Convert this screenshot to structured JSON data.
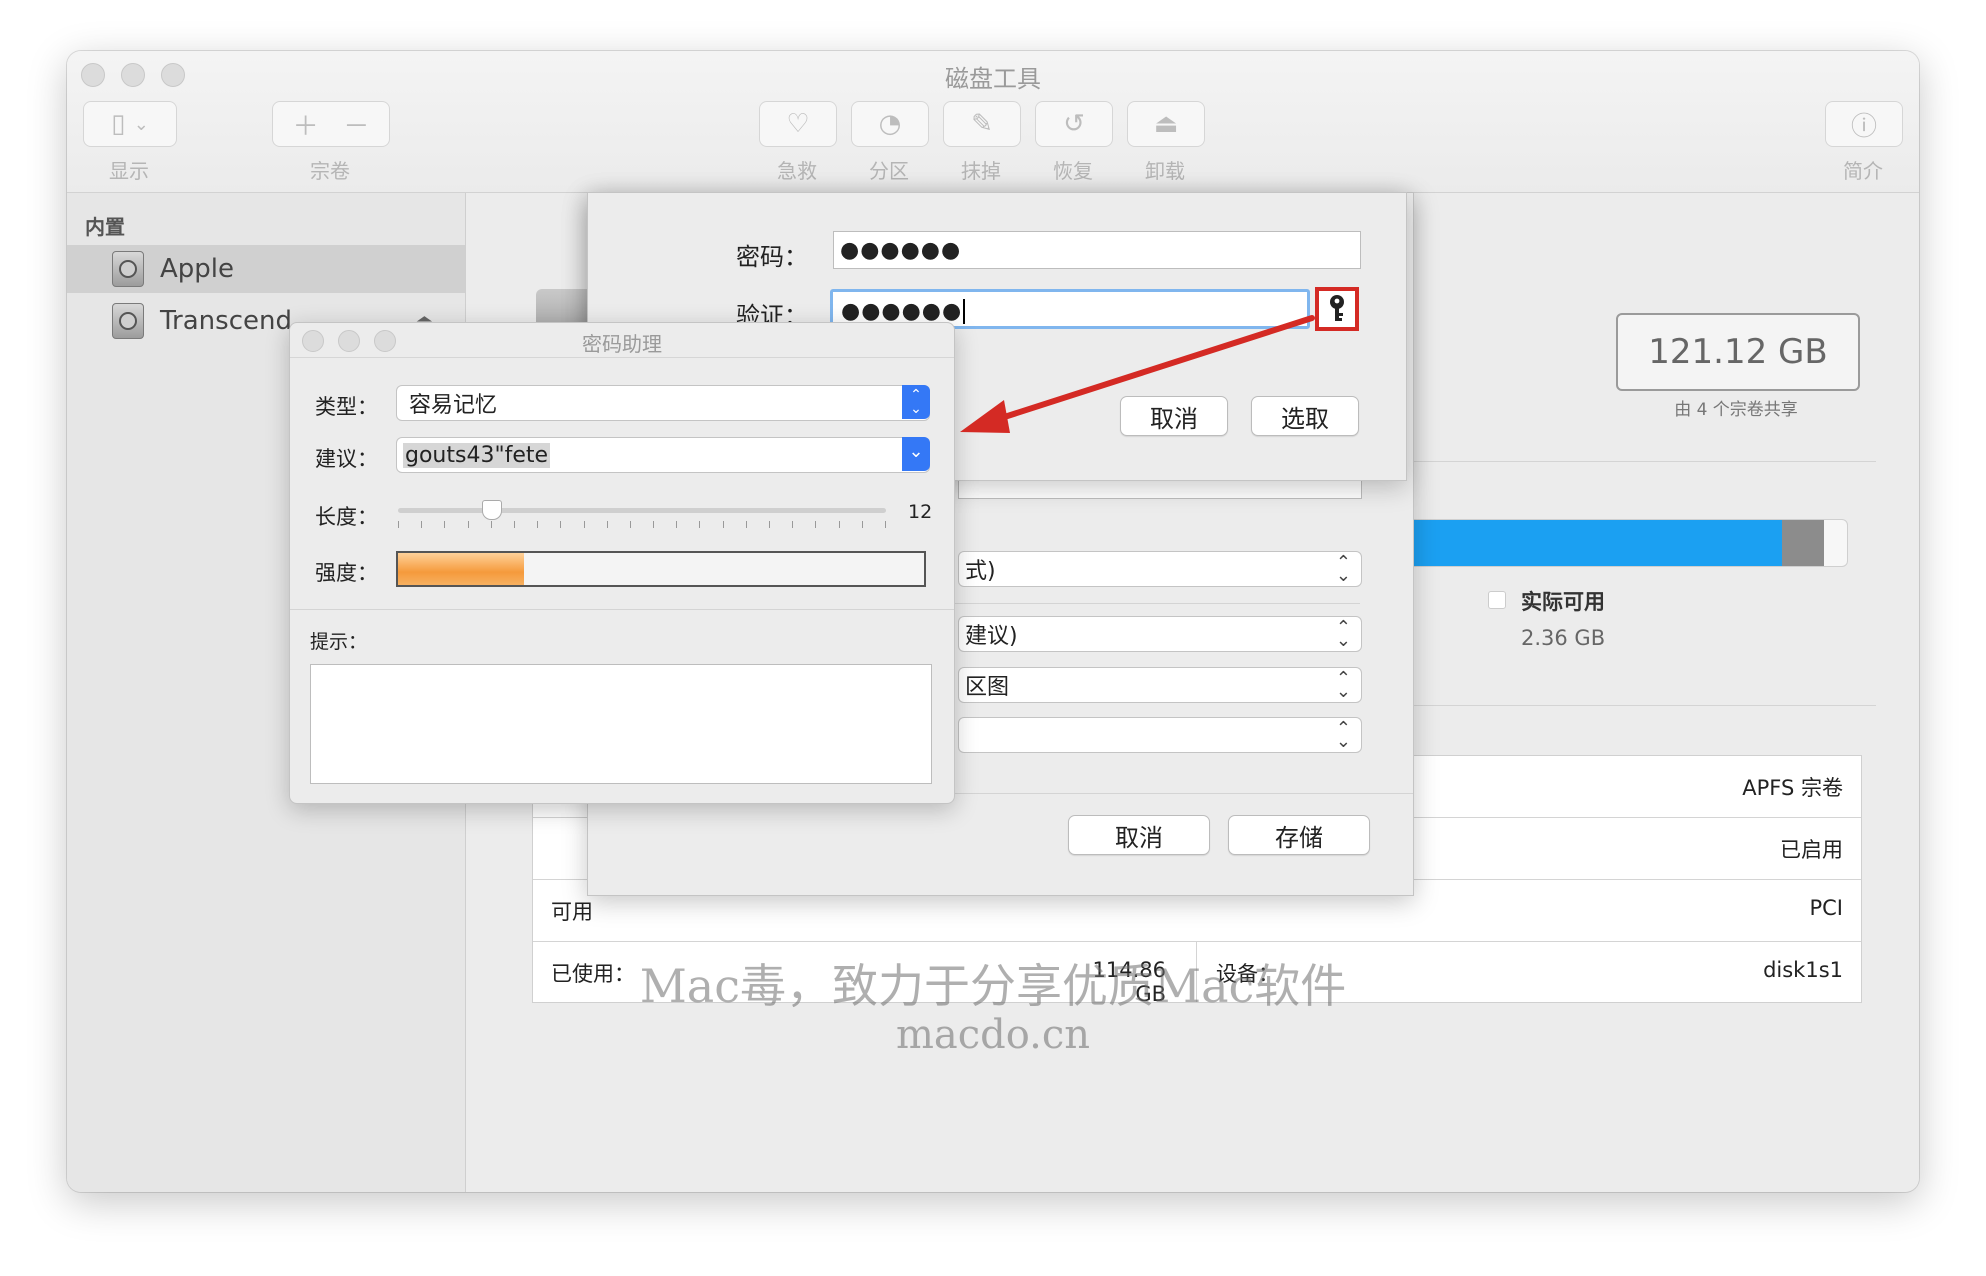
{
  "window": {
    "title": "磁盘工具"
  },
  "toolbar": {
    "view_label": "显示",
    "volume_label": "宗卷",
    "firstaid_label": "急救",
    "partition_label": "分区",
    "erase_label": "抹掉",
    "restore_label": "恢复",
    "unmount_label": "卸载",
    "info_label": "简介"
  },
  "sidebar": {
    "section": "内置",
    "items": [
      {
        "label": "Apple"
      },
      {
        "label": "Transcend"
      }
    ]
  },
  "main": {
    "capacity": "121.12 GB",
    "shared": "由 4 个宗卷共享",
    "available_label": "实际可用",
    "available_value": "2.36 GB",
    "usage_fraction": 0.95,
    "info_rows": [
      {
        "value": "APFS 宗卷"
      },
      {
        "value": "已启用"
      },
      {
        "left_label": "可用",
        "value": "PCI"
      },
      {
        "left_label": "已使用：",
        "left_value": "114.86 GB",
        "right_label": "设备：",
        "value": "disk1s1"
      }
    ]
  },
  "save_sheet": {
    "format_value": "式)",
    "encrypt_value": "建议)",
    "scheme_value": "区图",
    "cancel": "取消",
    "save": "存储"
  },
  "password_dialog": {
    "password_label": "密码：",
    "password_value": "●●●●●●",
    "verify_label": "验证：",
    "verify_value": "●●●●●●",
    "cancel": "取消",
    "choose": "选取"
  },
  "assistant": {
    "title": "密码助理",
    "type_label": "类型：",
    "type_value": "容易记忆",
    "suggest_label": "建议：",
    "suggest_value": "gouts43\"fete",
    "length_label": "长度：",
    "length_value": "12",
    "length_fraction": 0.19,
    "strength_label": "强度：",
    "strength_fraction": 0.24,
    "hint_label": "提示："
  },
  "watermark": {
    "line1": "Mac毒，致力于分享优质Mac软件",
    "line2": "macdo.cn"
  },
  "colors": {
    "annotation": "#d42a24",
    "selection_blue": "#1ba0f2",
    "strength_orange": "#f59a3c"
  }
}
